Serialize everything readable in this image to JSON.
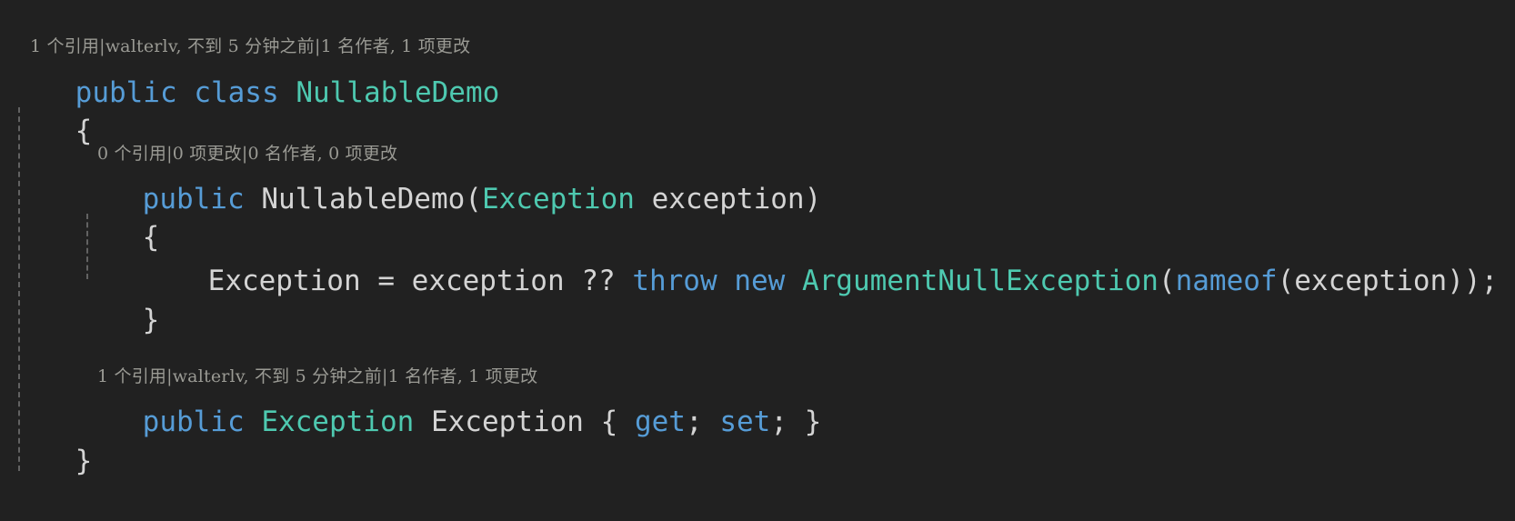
{
  "editor": {
    "language": "csharp",
    "theme": "dark",
    "background_color": "#212121",
    "colors": {
      "keyword": "#569cd6",
      "type": "#4ec9b0",
      "identifier": "#d4d4d4",
      "codelens": "#9a9a94",
      "indent_guide": "#6e6e6e"
    }
  },
  "codelens": {
    "class_header": {
      "references": "1 个引用",
      "author_change": "walterlv, 不到 5 分钟之前",
      "authors_changes": "1 名作者, 1 项更改",
      "separator": "|",
      "full": "1 个引用|walterlv, 不到 5 分钟之前|1 名作者, 1 项更改"
    },
    "constructor_header": {
      "references": "0 个引用",
      "changes": "0 项更改",
      "authors_changes": "0 名作者, 0 项更改",
      "separator": "|",
      "full": "0 个引用|0 项更改|0 名作者, 0 项更改"
    },
    "property_header": {
      "references": "1 个引用",
      "author_change": "walterlv, 不到 5 分钟之前",
      "authors_changes": "1 名作者, 1 项更改",
      "separator": "|",
      "full": "1 个引用|walterlv, 不到 5 分钟之前|1 名作者, 1 项更改"
    }
  },
  "code": {
    "class_decl": {
      "kw_public": "public",
      "kw_class": "class",
      "type_name": "NullableDemo",
      "space": " "
    },
    "class_open_brace": "{",
    "class_close_brace": "}",
    "ctor_decl": {
      "kw_public": "public",
      "name": "NullableDemo",
      "paren_open": "(",
      "param_type": "Exception",
      "param_name": "exception",
      "paren_close": ")"
    },
    "ctor_open_brace": "{",
    "ctor_close_brace": "}",
    "ctor_body": {
      "target": "Exception",
      "assign": "=",
      "source": "exception",
      "coalesce": "??",
      "kw_throw": "throw",
      "kw_new": "new",
      "exception_type": "ArgumentNullException",
      "paren_open": "(",
      "kw_nameof": "nameof",
      "nameof_open": "(",
      "nameof_arg": "exception",
      "nameof_close": ")",
      "paren_close": ")",
      "semicolon": ";"
    },
    "property_decl": {
      "kw_public": "public",
      "type": "Exception",
      "name": "Exception",
      "brace_open": "{",
      "kw_get": "get",
      "semicolon_1": ";",
      "kw_set": "set",
      "semicolon_2": ";",
      "brace_close": "}"
    }
  }
}
